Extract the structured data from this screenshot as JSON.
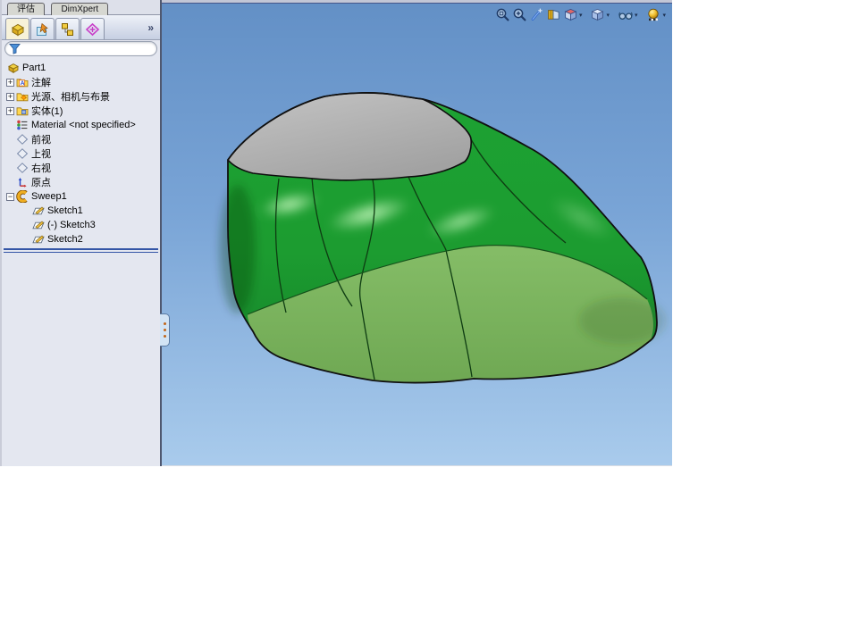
{
  "command_tabs": {
    "items": [
      {
        "label": "评估"
      },
      {
        "label": "DimXpert"
      }
    ]
  },
  "manager_panel": {
    "tabs": [
      {
        "name": "featuremanager-design-tree",
        "active": true
      },
      {
        "name": "propertymanager",
        "active": false
      },
      {
        "name": "configurationmanager",
        "active": false
      },
      {
        "name": "dimxpertmanager",
        "active": false
      }
    ],
    "overflow_chevron": "»",
    "filter": {
      "value": "",
      "placeholder": ""
    },
    "tree": [
      {
        "label": "Part1",
        "icon": "part",
        "indent": 0
      },
      {
        "label": "注解",
        "icon": "annotations-folder",
        "indent": 1,
        "expander": "+"
      },
      {
        "label": "光源、相机与布景",
        "icon": "lights-folder",
        "indent": 1,
        "expander": "+"
      },
      {
        "label": "实体(1)",
        "icon": "solid-bodies-folder",
        "indent": 1,
        "expander": "+"
      },
      {
        "label": "Material <not specified>",
        "icon": "material",
        "indent": 1
      },
      {
        "label": "前视",
        "icon": "plane",
        "indent": 1
      },
      {
        "label": "上视",
        "icon": "plane",
        "indent": 1
      },
      {
        "label": "右视",
        "icon": "plane",
        "indent": 1
      },
      {
        "label": "原点",
        "icon": "origin",
        "indent": 1
      },
      {
        "label": "Sweep1",
        "icon": "sweep",
        "indent": 1,
        "expander": "−"
      },
      {
        "label": "Sketch1",
        "icon": "sketch",
        "indent": 2
      },
      {
        "label": "(-) Sketch3",
        "icon": "sketch",
        "indent": 2
      },
      {
        "label": "Sketch2",
        "icon": "sketch",
        "indent": 2
      }
    ]
  },
  "viewport": {
    "hud_toolbar": {
      "buttons": [
        {
          "name": "zoom-to-fit"
        },
        {
          "name": "zoom-to-area"
        },
        {
          "name": "magic-wand"
        },
        {
          "name": "section-view"
        },
        {
          "name": "view-orientation",
          "dropdown": true
        },
        {
          "name": "display-style",
          "dropdown": true
        },
        {
          "name": "hide-show-items",
          "dropdown": true
        },
        {
          "name": "edit-appearance",
          "dropdown": true
        }
      ]
    },
    "dropdown_caret": "▾",
    "colors": {
      "sky_top": "#6390c6",
      "sky_bottom": "#a9cbec",
      "model_green": "#1da233",
      "model_band_green": "#7db561",
      "top_face_gray": "#b5b5b5",
      "edge_black": "#101010",
      "rollback_blue": "#3456a6"
    }
  }
}
